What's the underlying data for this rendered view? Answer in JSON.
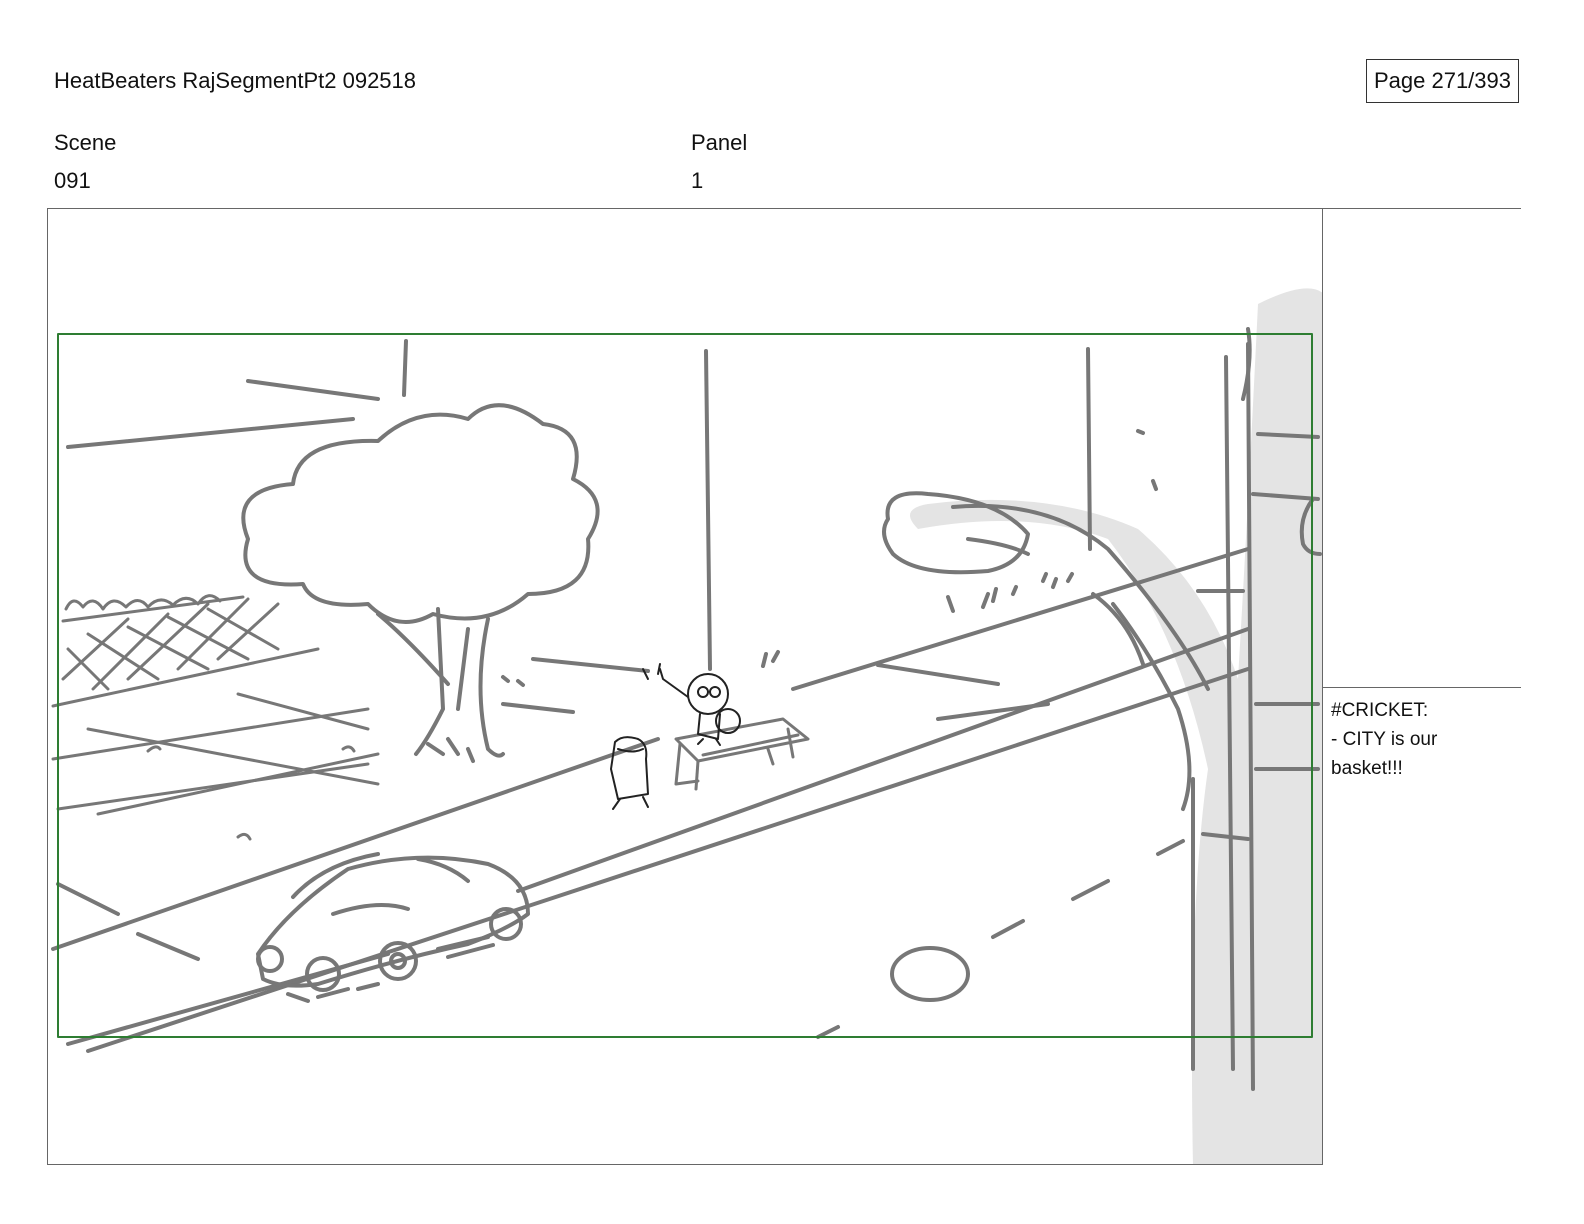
{
  "header": {
    "title": "HeatBeaters RajSegmentPt2 092518",
    "page": "Page 271/393"
  },
  "scene": {
    "label": "Scene",
    "value": "091"
  },
  "panel": {
    "label": "Panel",
    "value": "1"
  },
  "notes": [
    "#CRICKET:",
    "- CITY is our",
    "basket!!!"
  ],
  "colors": {
    "sketch": "#777777",
    "safe_frame": "#2e7d32",
    "pole_fill": "#e4e4e4"
  }
}
